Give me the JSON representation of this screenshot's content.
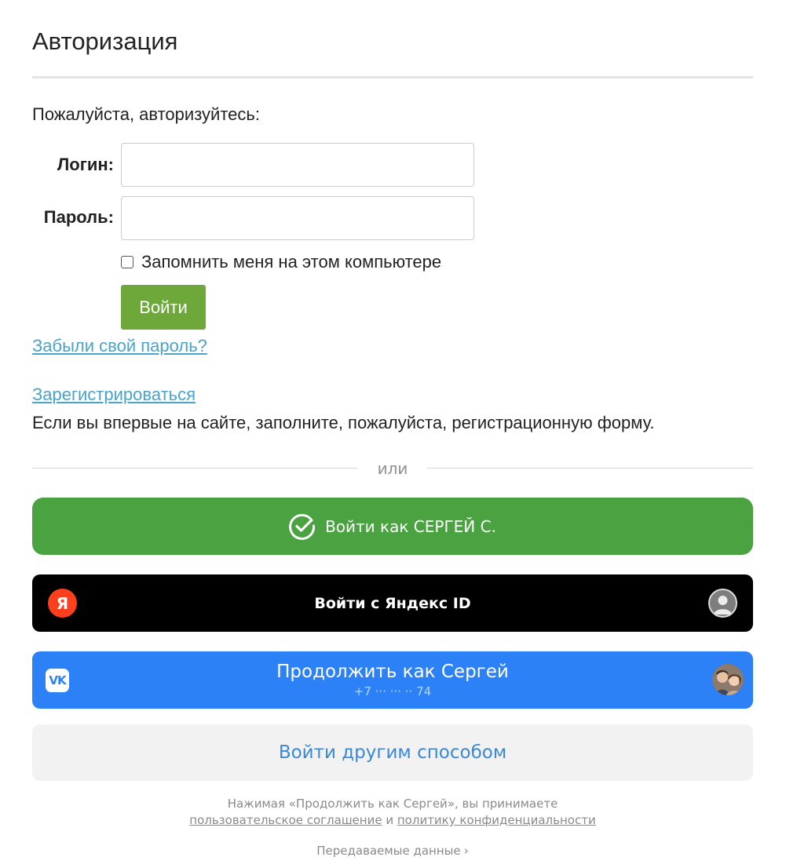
{
  "page": {
    "title": "Авторизация",
    "prompt": "Пожалуйста, авторизуйтесь:"
  },
  "form": {
    "login_label": "Логин:",
    "login_value": "",
    "password_label": "Пароль:",
    "password_value": "",
    "remember_label": "Запомнить меня на этом компьютере",
    "remember_checked": false,
    "submit_label": "Войти",
    "submit_color": "#6fa83a"
  },
  "links": {
    "forgot_password": "Забыли свой пароль?",
    "register": "Зарегистрироваться",
    "register_note": "Если вы впервые на сайте, заполните, пожалуйста, регистрационную форму.",
    "link_color": "#4aa3c8"
  },
  "divider": {
    "text": "или"
  },
  "sber": {
    "label": "Войти как СЕРГЕЙ С.",
    "icon": "sber-check-icon",
    "color": "#4aa340"
  },
  "yandex": {
    "label": "Войти с Яндекс ID",
    "logo_letter": "Я",
    "logo_color": "#fc3f1d",
    "icon": "avatar-placeholder-icon",
    "color": "#000000"
  },
  "vk": {
    "logo_text": "VK",
    "title": "Продолжить как Сергей",
    "phone": "+7 ··· ··· ·· 74",
    "icon": "user-photo-avatar",
    "color": "#2d81f7"
  },
  "other": {
    "label": "Войти другим способом",
    "text_color": "#3a88d6"
  },
  "terms": {
    "line1": "Нажимая «Продолжить как Сергей», вы принимаете",
    "agreement_link": "пользовательское соглашение",
    "conjunction": "и",
    "privacy_link": "политику конфиденциальности",
    "data_link": "Передаваемые данные",
    "data_icon": "chevron-right-icon"
  }
}
